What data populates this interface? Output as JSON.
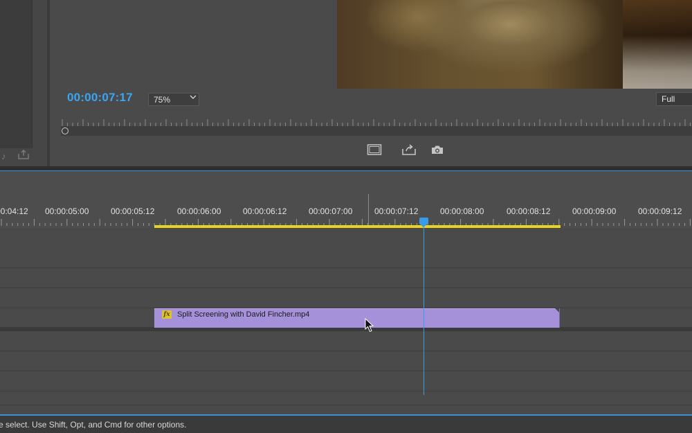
{
  "program_monitor": {
    "timecode": "00:00:07:17",
    "zoom": "75%",
    "quality": "Full",
    "icons": [
      "safe-margins-icon",
      "export-frame-share-icon",
      "camera-icon"
    ]
  },
  "timeline": {
    "ruler_labels": [
      "00:04:12",
      "00:00:05:00",
      "00:00:05:12",
      "00:00:06:00",
      "00:00:06:12",
      "00:00:07:00",
      "00:00:07:12",
      "00:00:08:00",
      "00:00:08:12",
      "00:00:09:00",
      "00:00:09:12"
    ],
    "clip": {
      "name": "Split Screening with David Fincher.mp4",
      "fx_badge": "fx",
      "color": "#a591d9"
    },
    "playhead_color": "#3a9ce8",
    "work_area_color": "#e9d421"
  },
  "status_bar": {
    "text": "e select. Use Shift, Opt, and Cmd for other options."
  },
  "colors": {
    "accent": "#3aa5f2",
    "panel_bg": "#4a4a4a"
  }
}
